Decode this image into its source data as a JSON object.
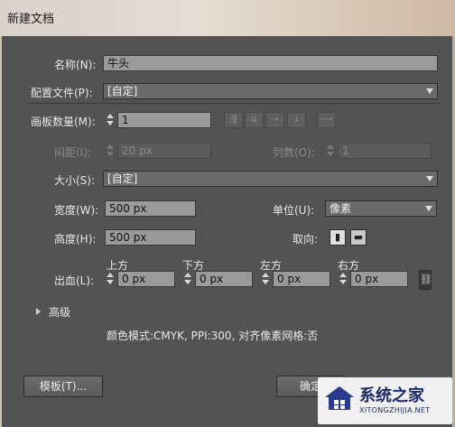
{
  "window": {
    "title": "新建文档"
  },
  "form": {
    "name_label": "名称(N):",
    "name_value": "牛头",
    "profile_label": "配置文件(P):",
    "profile_value": "[自定]",
    "artboards_label": "画板数量(M):",
    "artboards_value": "1",
    "spacing_label": "间距(I):",
    "spacing_value": "20 px",
    "columns_label": "列数(O):",
    "columns_value": "1",
    "size_label": "大小(S):",
    "size_value": "[自定]",
    "width_label": "宽度(W):",
    "width_value": "500 px",
    "units_label": "单位(U):",
    "units_value": "像素",
    "height_label": "高度(H):",
    "height_value": "500 px",
    "orientation_label": "取向:",
    "bleed_label": "出血(L):",
    "bleed_top_label": "上方",
    "bleed_top_value": "0 px",
    "bleed_bottom_label": "下方",
    "bleed_bottom_value": "0 px",
    "bleed_left_label": "左方",
    "bleed_left_value": "0 px",
    "bleed_right_label": "右方",
    "bleed_right_value": "0 px",
    "advanced_label": "高级",
    "summary": "颜色模式:CMYK, PPI:300, 对齐像素网格:否"
  },
  "buttons": {
    "templates_label": "模板(T)...",
    "ok_label": "确定"
  },
  "watermark": {
    "text": "系统之家",
    "url": "XITONGZHIJIA.NET"
  },
  "icons": {
    "arrange_grid_row": "grid-by-row-icon",
    "arrange_grid_col": "grid-by-column-icon",
    "arrange_row": "arrange-row-icon",
    "arrange_col": "arrange-column-icon",
    "layout_direction": "right-arrow-icon",
    "portrait": "portrait-icon",
    "landscape": "landscape-icon",
    "link": "link-icon"
  }
}
